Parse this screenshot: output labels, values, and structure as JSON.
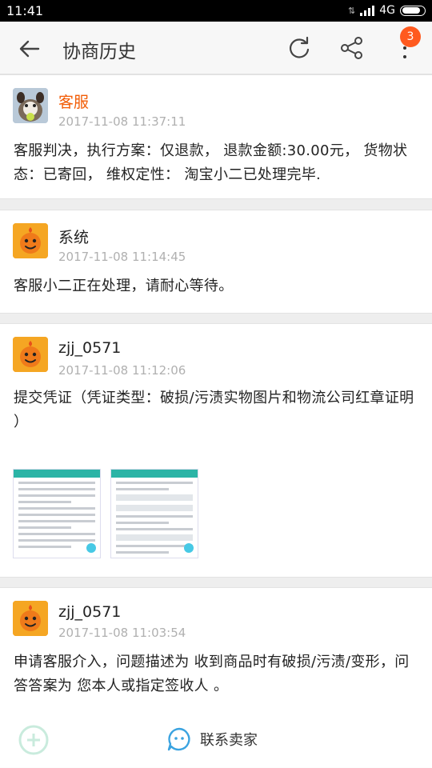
{
  "status_bar": {
    "time": "11:41",
    "network": "4G"
  },
  "header": {
    "title": "协商历史",
    "badge_count": "3"
  },
  "records": [
    {
      "author": "客服",
      "time": "2017-11-08 11:37:11",
      "message": "客服判决，执行方案：仅退款， 退款金额:30.00元， 货物状态：已寄回， 维权定性： 淘宝小二已处理完毕."
    },
    {
      "author": "系统",
      "time": "2017-11-08 11:14:45",
      "message": "客服小二正在处理，请耐心等待。"
    },
    {
      "author": "zjj_0571",
      "time": "2017-11-08 11:12:06",
      "message": "提交凭证（凭证类型：破损/污渍实物图片和物流公司红章证明 ）"
    },
    {
      "author": "zjj_0571",
      "time": "2017-11-08 11:03:54",
      "message": "申请客服介入，问题描述为  收到商品时有破损/污渍/变形，问答答案为  您本人或指定签收人  。"
    }
  ],
  "footer": {
    "contact_label": "联系卖家"
  },
  "colors": {
    "accent": "#f25c05",
    "badge": "#ff5a1f",
    "mascot": "#f5a623",
    "contact_icon": "#3aa3e0"
  }
}
